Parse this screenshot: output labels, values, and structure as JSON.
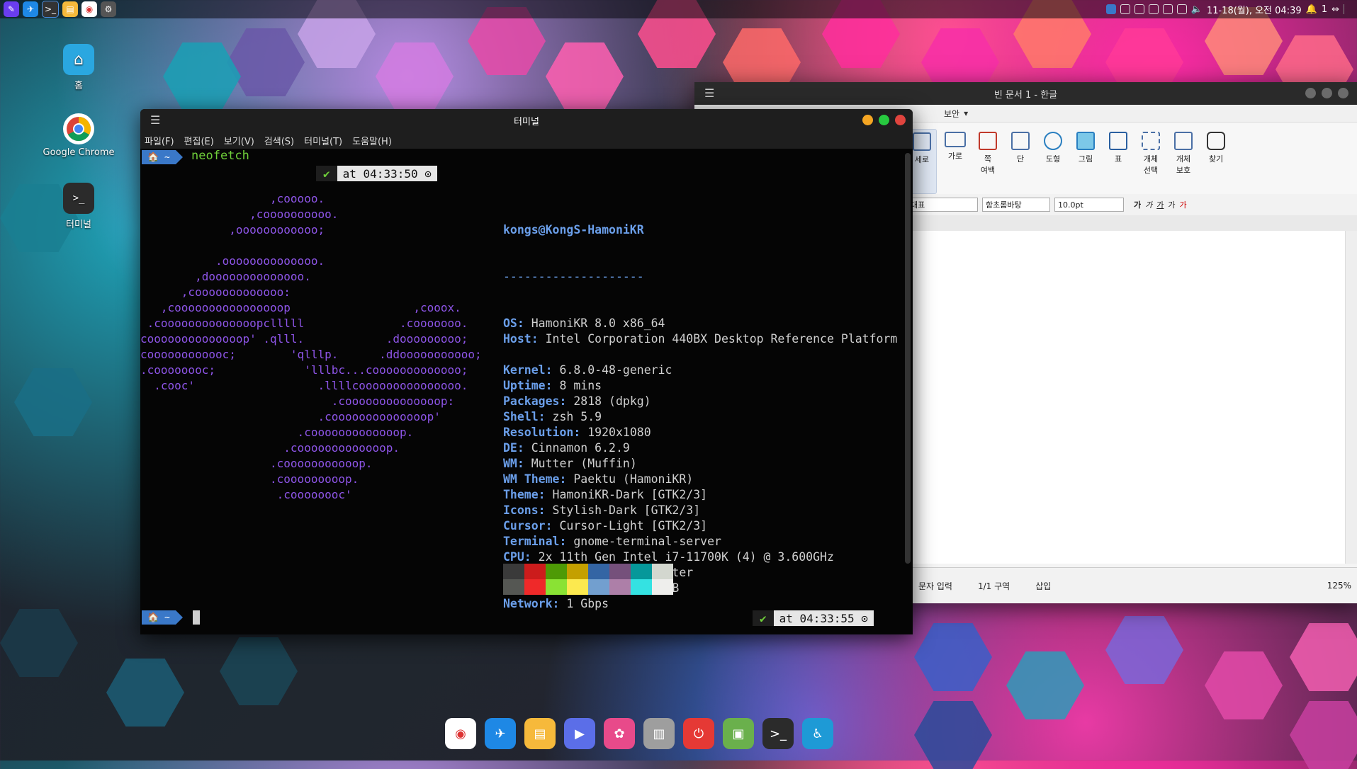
{
  "top_panel": {
    "apps": [
      {
        "icon": "pen-icon",
        "color": "#6a3df0"
      },
      {
        "icon": "bird-icon",
        "color": "#1e88e5"
      },
      {
        "icon": "terminal-icon",
        "color": "#333333"
      },
      {
        "icon": "folder-icon",
        "color": "#f6b93b"
      },
      {
        "icon": "chrome-icon",
        "color": "#ffffff"
      },
      {
        "icon": "settings-icon",
        "color": "#555555"
      }
    ],
    "clock": "11-18(월), 오전 04:39",
    "notif_count": "1"
  },
  "desktop": {
    "icons": [
      {
        "label": "홈",
        "icon": "home-folder-icon"
      },
      {
        "label": "Google Chrome",
        "icon": "chrome-icon"
      },
      {
        "label": "터미널",
        "icon": "terminal-icon"
      }
    ]
  },
  "terminal": {
    "title": "터미널",
    "menu": [
      "파일(F)",
      "편집(E)",
      "보기(V)",
      "검색(S)",
      "터미널(T)",
      "도움말(H)"
    ],
    "prompt_home": "🏠 ~",
    "command": "neofetch",
    "time1": "at 04:33:50 ⊙",
    "time2": "at 04:33:55 ⊙",
    "check": "✔",
    "logo": "                   ,cooooo.\n                ,coooooooooo.\n             ,oooooooooooo;\n\n           .oooooooooooooo.\n        ,doooooooooooooo.\n      ,cooooooooooooo:\n   ,coooooooooooooooop                  ,cooox.\n .coooooooooooooopclllll              .cooooooo.\ncoooooooooooooop' .qlll.            .dooooooooo;\ncoooooooooooc;        'qlllp.      .ddooooooooooo;\n.coooooooc;             'lllbc...cooooooooooooo;\n  .cooc'                  .llllcooooooooooooooo.\n                            .coooooooooooooop:\n                          .coooooooooooooop'\n                       .cooooooooooooop.\n                     .cooooooooooooop.\n                   .cooooooooooop.\n                   .cooooooooop.\n                    .coooooooc'",
    "user_host": "kongs@KongS-HamoniKR",
    "separator": "--------------------",
    "info": [
      {
        "k": "OS",
        "v": "HamoniKR 8.0 x86_64"
      },
      {
        "k": "Host",
        "v": "Intel Corporation 440BX Desktop Reference Platform"
      },
      {
        "k": "",
        "v": ""
      },
      {
        "k": "Kernel",
        "v": "6.8.0-48-generic"
      },
      {
        "k": "Uptime",
        "v": "8 mins"
      },
      {
        "k": "Packages",
        "v": "2818 (dpkg)"
      },
      {
        "k": "Shell",
        "v": "zsh 5.9"
      },
      {
        "k": "Resolution",
        "v": "1920x1080"
      },
      {
        "k": "DE",
        "v": "Cinnamon 6.2.9"
      },
      {
        "k": "WM",
        "v": "Mutter (Muffin)"
      },
      {
        "k": "WM Theme",
        "v": "Paektu (HamoniKR)"
      },
      {
        "k": "Theme",
        "v": "HamoniKR-Dark [GTK2/3]"
      },
      {
        "k": "Icons",
        "v": "Stylish-Dark [GTK2/3]"
      },
      {
        "k": "Cursor",
        "v": "Cursor-Light [GTK2/3]"
      },
      {
        "k": "Terminal",
        "v": "gnome-terminal-server"
      },
      {
        "k": "CPU",
        "v": "2x 11th Gen Intel i7-11700K (4) @ 3.600GHz"
      },
      {
        "k": "GPU",
        "v": "VMware SVGA II Adapter"
      },
      {
        "k": "Memory",
        "v": "1.6 GiB / 7.7 GiB"
      },
      {
        "k": "Network",
        "v": "1 Gbps"
      }
    ],
    "colors_row1": [
      "#3a3a3a",
      "#cc1c1c",
      "#4e9a06",
      "#c4a000",
      "#3465a4",
      "#75507b",
      "#06989a",
      "#d3d7cf"
    ],
    "colors_row2": [
      "#555753",
      "#ef2929",
      "#8ae234",
      "#fce94f",
      "#729fcf",
      "#ad7fa8",
      "#34e2e2",
      "#eeeeec"
    ]
  },
  "hwp": {
    "title": "빈 문서 1 - 한글",
    "menu_security": "보안",
    "ribbon": [
      {
        "label": "세로",
        "selected": true
      },
      {
        "label": "가로",
        "selected": false
      },
      {
        "label": "쪽\n여백",
        "selected": false
      },
      {
        "label": "단",
        "selected": false
      },
      {
        "label": "도형",
        "selected": false
      },
      {
        "label": "그림",
        "selected": false
      },
      {
        "label": "표",
        "selected": false
      },
      {
        "label": "개체\n선택",
        "selected": false
      },
      {
        "label": "개체\n보호",
        "selected": false
      },
      {
        "label": "찾기",
        "selected": false
      }
    ],
    "style": "대표",
    "font": "함초롬바탕",
    "size": "10.0pt",
    "fmt_chars": [
      "가",
      "가",
      "가",
      "가",
      "가"
    ],
    "status": [
      "문자 입력",
      "1/1 구역",
      "삽입"
    ],
    "zoom": "125%"
  },
  "dock": [
    {
      "icon": "chrome-icon",
      "color": "#ffffff"
    },
    {
      "icon": "bird-icon",
      "color": "#1e88e5"
    },
    {
      "icon": "folder-icon",
      "color": "#f6b93b"
    },
    {
      "icon": "media-player-icon",
      "color": "#5b6ee8"
    },
    {
      "icon": "pinwheel-icon",
      "color": "#e84a8a"
    },
    {
      "icon": "trash-icon",
      "color": "#9e9e9e"
    },
    {
      "icon": "power-icon",
      "color": "#e53935"
    },
    {
      "icon": "software-center-icon",
      "color": "#6ab04c"
    },
    {
      "icon": "terminal-icon",
      "color": "#2b2b2b"
    },
    {
      "icon": "accessibility-icon",
      "color": "#1e9ad6"
    }
  ]
}
